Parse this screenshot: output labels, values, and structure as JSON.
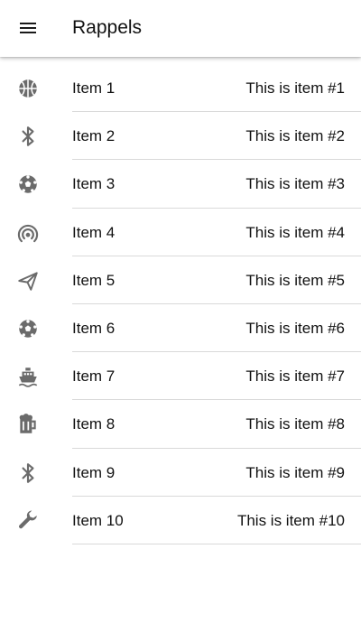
{
  "header": {
    "title": "Rappels",
    "menu_icon": "menu-icon"
  },
  "colors": {
    "icon": "#6b6b6b",
    "divider": "#d9d9d9",
    "text": "#111111",
    "background": "#ffffff"
  },
  "items": [
    {
      "label": "Item 1",
      "description": "This is item #1",
      "icon": "basketball-icon"
    },
    {
      "label": "Item 2",
      "description": "This is item #2",
      "icon": "bluetooth-icon"
    },
    {
      "label": "Item 3",
      "description": "This is item #3",
      "icon": "soccer-ball-icon"
    },
    {
      "label": "Item 4",
      "description": "This is item #4",
      "icon": "wifi-tethering-icon"
    },
    {
      "label": "Item 5",
      "description": "This is item #5",
      "icon": "paper-plane-icon"
    },
    {
      "label": "Item 6",
      "description": "This is item #6",
      "icon": "soccer-ball-icon"
    },
    {
      "label": "Item 7",
      "description": "This is item #7",
      "icon": "boat-icon"
    },
    {
      "label": "Item 8",
      "description": "This is item #8",
      "icon": "beer-mug-icon"
    },
    {
      "label": "Item 9",
      "description": "This is item #9",
      "icon": "bluetooth-icon"
    },
    {
      "label": "Item 10",
      "description": "This is item #10",
      "icon": "wrench-icon"
    }
  ]
}
